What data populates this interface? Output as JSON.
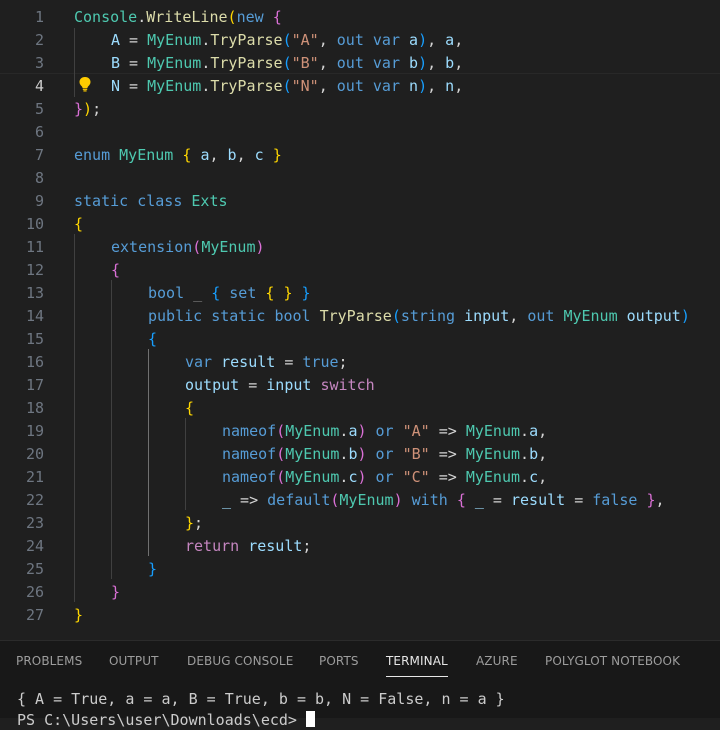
{
  "editor": {
    "current_line": 4,
    "lines": [
      {
        "n": "1",
        "segs": [
          [
            "Console",
            "ty"
          ],
          [
            ".",
            "pl"
          ],
          [
            "WriteLine",
            "fn"
          ],
          [
            "(",
            "b1"
          ],
          [
            "new",
            "kw"
          ],
          [
            " ",
            "pl"
          ],
          [
            "{",
            "b2"
          ]
        ]
      },
      {
        "n": "2",
        "segs": [
          [
            "A",
            "va"
          ],
          [
            " = ",
            "pl"
          ],
          [
            "MyEnum",
            "ty"
          ],
          [
            ".",
            "pl"
          ],
          [
            "TryParse",
            "fn"
          ],
          [
            "(",
            "b3"
          ],
          [
            "\"A\"",
            "st"
          ],
          [
            ", ",
            "pl"
          ],
          [
            "out",
            "kw"
          ],
          [
            " ",
            "pl"
          ],
          [
            "var",
            "kw"
          ],
          [
            " ",
            "pl"
          ],
          [
            "a",
            "va"
          ],
          [
            ")",
            "b3"
          ],
          [
            ", ",
            "pl"
          ],
          [
            "a",
            "va"
          ],
          [
            ",",
            "pl"
          ]
        ]
      },
      {
        "n": "3",
        "segs": [
          [
            "B",
            "va"
          ],
          [
            " = ",
            "pl"
          ],
          [
            "MyEnum",
            "ty"
          ],
          [
            ".",
            "pl"
          ],
          [
            "TryParse",
            "fn"
          ],
          [
            "(",
            "b3"
          ],
          [
            "\"B\"",
            "st"
          ],
          [
            ", ",
            "pl"
          ],
          [
            "out",
            "kw"
          ],
          [
            " ",
            "pl"
          ],
          [
            "var",
            "kw"
          ],
          [
            " ",
            "pl"
          ],
          [
            "b",
            "va"
          ],
          [
            ")",
            "b3"
          ],
          [
            ", ",
            "pl"
          ],
          [
            "b",
            "va"
          ],
          [
            ",",
            "pl"
          ]
        ]
      },
      {
        "n": "4",
        "segs": [
          [
            "N",
            "va"
          ],
          [
            " = ",
            "pl"
          ],
          [
            "MyEnum",
            "ty"
          ],
          [
            ".",
            "pl"
          ],
          [
            "TryParse",
            "fn"
          ],
          [
            "(",
            "b3"
          ],
          [
            "\"N\"",
            "st"
          ],
          [
            ", ",
            "pl"
          ],
          [
            "out",
            "kw"
          ],
          [
            " ",
            "pl"
          ],
          [
            "var",
            "kw"
          ],
          [
            " ",
            "pl"
          ],
          [
            "n",
            "va"
          ],
          [
            ")",
            "b3"
          ],
          [
            ", ",
            "pl"
          ],
          [
            "n",
            "va"
          ],
          [
            ",",
            "pl"
          ]
        ]
      },
      {
        "n": "5",
        "segs": [
          [
            "}",
            "b2"
          ],
          [
            ")",
            "b1"
          ],
          [
            ";",
            "pl"
          ]
        ]
      },
      {
        "n": "6",
        "segs": []
      },
      {
        "n": "7",
        "segs": [
          [
            "enum",
            "kw"
          ],
          [
            " ",
            "pl"
          ],
          [
            "MyEnum",
            "ty"
          ],
          [
            " ",
            "pl"
          ],
          [
            "{",
            "b1"
          ],
          [
            " ",
            "pl"
          ],
          [
            "a",
            "va"
          ],
          [
            ", ",
            "pl"
          ],
          [
            "b",
            "va"
          ],
          [
            ", ",
            "pl"
          ],
          [
            "c",
            "va"
          ],
          [
            " ",
            "pl"
          ],
          [
            "}",
            "b1"
          ]
        ]
      },
      {
        "n": "8",
        "segs": []
      },
      {
        "n": "9",
        "segs": [
          [
            "static",
            "kw"
          ],
          [
            " ",
            "pl"
          ],
          [
            "class",
            "kw"
          ],
          [
            " ",
            "pl"
          ],
          [
            "Exts",
            "ty"
          ]
        ]
      },
      {
        "n": "10",
        "segs": [
          [
            "{",
            "b1"
          ]
        ]
      },
      {
        "n": "11",
        "segs": [
          [
            "extension",
            "kw"
          ],
          [
            "(",
            "b2"
          ],
          [
            "MyEnum",
            "ty"
          ],
          [
            ")",
            "b2"
          ]
        ]
      },
      {
        "n": "12",
        "segs": [
          [
            "{",
            "b2"
          ]
        ]
      },
      {
        "n": "13",
        "segs": [
          [
            "bool",
            "kw"
          ],
          [
            " ",
            "pl"
          ],
          [
            "_",
            "dg"
          ],
          [
            " ",
            "pl"
          ],
          [
            "{",
            "b3"
          ],
          [
            " ",
            "pl"
          ],
          [
            "set",
            "kw"
          ],
          [
            " ",
            "pl"
          ],
          [
            "{",
            "b1"
          ],
          [
            " ",
            "pl"
          ],
          [
            "}",
            "b1"
          ],
          [
            " ",
            "pl"
          ],
          [
            "}",
            "b3"
          ]
        ]
      },
      {
        "n": "14",
        "segs": [
          [
            "public",
            "kw"
          ],
          [
            " ",
            "pl"
          ],
          [
            "static",
            "kw"
          ],
          [
            " ",
            "pl"
          ],
          [
            "bool",
            "kw"
          ],
          [
            " ",
            "pl"
          ],
          [
            "TryParse",
            "fn"
          ],
          [
            "(",
            "b3"
          ],
          [
            "string",
            "kw"
          ],
          [
            " ",
            "pl"
          ],
          [
            "input",
            "va"
          ],
          [
            ", ",
            "pl"
          ],
          [
            "out",
            "kw"
          ],
          [
            " ",
            "pl"
          ],
          [
            "MyEnum",
            "ty"
          ],
          [
            " ",
            "pl"
          ],
          [
            "output",
            "va"
          ],
          [
            ")",
            "b3"
          ]
        ]
      },
      {
        "n": "15",
        "segs": [
          [
            "{",
            "b3"
          ]
        ]
      },
      {
        "n": "16",
        "segs": [
          [
            "var",
            "kw"
          ],
          [
            " ",
            "pl"
          ],
          [
            "result",
            "va"
          ],
          [
            " = ",
            "pl"
          ],
          [
            "true",
            "kw"
          ],
          [
            ";",
            "pl"
          ]
        ]
      },
      {
        "n": "17",
        "segs": [
          [
            "output",
            "va"
          ],
          [
            " = ",
            "pl"
          ],
          [
            "input",
            "va"
          ],
          [
            " ",
            "pl"
          ],
          [
            "switch",
            "ct"
          ]
        ]
      },
      {
        "n": "18",
        "segs": [
          [
            "{",
            "b1"
          ]
        ]
      },
      {
        "n": "19",
        "segs": [
          [
            "nameof",
            "kw"
          ],
          [
            "(",
            "b2"
          ],
          [
            "MyEnum",
            "ty"
          ],
          [
            ".",
            "pl"
          ],
          [
            "a",
            "va"
          ],
          [
            ")",
            "b2"
          ],
          [
            " ",
            "pl"
          ],
          [
            "or",
            "kw"
          ],
          [
            " ",
            "pl"
          ],
          [
            "\"A\"",
            "st"
          ],
          [
            " => ",
            "pl"
          ],
          [
            "MyEnum",
            "ty"
          ],
          [
            ".",
            "pl"
          ],
          [
            "a",
            "va"
          ],
          [
            ",",
            "pl"
          ]
        ]
      },
      {
        "n": "20",
        "segs": [
          [
            "nameof",
            "kw"
          ],
          [
            "(",
            "b2"
          ],
          [
            "MyEnum",
            "ty"
          ],
          [
            ".",
            "pl"
          ],
          [
            "b",
            "va"
          ],
          [
            ")",
            "b2"
          ],
          [
            " ",
            "pl"
          ],
          [
            "or",
            "kw"
          ],
          [
            " ",
            "pl"
          ],
          [
            "\"B\"",
            "st"
          ],
          [
            " => ",
            "pl"
          ],
          [
            "MyEnum",
            "ty"
          ],
          [
            ".",
            "pl"
          ],
          [
            "b",
            "va"
          ],
          [
            ",",
            "pl"
          ]
        ]
      },
      {
        "n": "21",
        "segs": [
          [
            "nameof",
            "kw"
          ],
          [
            "(",
            "b2"
          ],
          [
            "MyEnum",
            "ty"
          ],
          [
            ".",
            "pl"
          ],
          [
            "c",
            "va"
          ],
          [
            ")",
            "b2"
          ],
          [
            " ",
            "pl"
          ],
          [
            "or",
            "kw"
          ],
          [
            " ",
            "pl"
          ],
          [
            "\"C\"",
            "st"
          ],
          [
            " => ",
            "pl"
          ],
          [
            "MyEnum",
            "ty"
          ],
          [
            ".",
            "pl"
          ],
          [
            "c",
            "va"
          ],
          [
            ",",
            "pl"
          ]
        ]
      },
      {
        "n": "22",
        "segs": [
          [
            "_",
            "va"
          ],
          [
            " => ",
            "pl"
          ],
          [
            "default",
            "kw"
          ],
          [
            "(",
            "b2"
          ],
          [
            "MyEnum",
            "ty"
          ],
          [
            ")",
            "b2"
          ],
          [
            " ",
            "pl"
          ],
          [
            "with",
            "kw"
          ],
          [
            " ",
            "pl"
          ],
          [
            "{",
            "b2"
          ],
          [
            " ",
            "pl"
          ],
          [
            "_",
            "va"
          ],
          [
            " = ",
            "pl"
          ],
          [
            "result",
            "va"
          ],
          [
            " = ",
            "pl"
          ],
          [
            "false",
            "kw"
          ],
          [
            " ",
            "pl"
          ],
          [
            "}",
            "b2"
          ],
          [
            ",",
            "pl"
          ]
        ]
      },
      {
        "n": "23",
        "segs": [
          [
            "}",
            "b1"
          ],
          [
            ";",
            "pl"
          ]
        ]
      },
      {
        "n": "24",
        "segs": [
          [
            "return",
            "ct"
          ],
          [
            " ",
            "pl"
          ],
          [
            "result",
            "va"
          ],
          [
            ";",
            "pl"
          ]
        ]
      },
      {
        "n": "25",
        "segs": [
          [
            "}",
            "b3"
          ]
        ]
      },
      {
        "n": "26",
        "segs": [
          [
            "}",
            "b2"
          ]
        ]
      },
      {
        "n": "27",
        "segs": [
          [
            "}",
            "b1"
          ]
        ]
      }
    ]
  },
  "panel": {
    "tabs": [
      {
        "label": "PROBLEMS",
        "active": false
      },
      {
        "label": "OUTPUT",
        "active": false
      },
      {
        "label": "DEBUG CONSOLE",
        "active": false
      },
      {
        "label": "PORTS",
        "active": false
      },
      {
        "label": "TERMINAL",
        "active": true
      },
      {
        "label": "AZURE",
        "active": false
      },
      {
        "label": "POLYGLOT NOTEBOOK",
        "active": false
      }
    ],
    "terminal": {
      "output": "{ A = True, a = a, B = True, b = b, N = False, n = a }",
      "prompt": "PS C:\\Users\\user\\Downloads\\ecd> "
    }
  },
  "colors": {
    "background": "#1f1f1f",
    "panel_background": "#181818",
    "lightbulb": "#ffcc00"
  }
}
